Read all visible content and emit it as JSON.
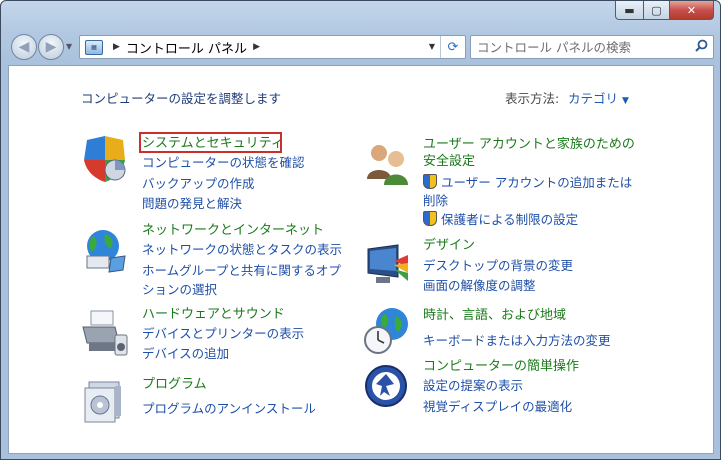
{
  "window": {
    "caption_buttons": {
      "minimize": "▬",
      "maximize": "▢",
      "close": "✕"
    }
  },
  "nav": {
    "back": "◀",
    "forward": "▶",
    "address_text": "コントロール パネル",
    "address_sep1": "▶",
    "address_sep2": "▶",
    "dropdown": "▼",
    "refresh": "⟳",
    "search_placeholder": "コントロール パネルの検索"
  },
  "content": {
    "header": "コンピューターの設定を調整します",
    "view_label": "表示方法:",
    "view_value": "カテゴリ",
    "view_arrow": "▼"
  },
  "categories": [
    {
      "title": "システムとセキュリティ",
      "links": [
        "コンピューターの状態を確認",
        "バックアップの作成",
        "問題の発見と解決"
      ]
    },
    {
      "title": "ネットワークとインターネット",
      "links": [
        "ネットワークの状態とタスクの表示",
        "ホームグループと共有に関するオプションの選択"
      ]
    },
    {
      "title": "ハードウェアとサウンド",
      "links": [
        "デバイスとプリンターの表示",
        "デバイスの追加"
      ]
    },
    {
      "title": "プログラム",
      "links": [
        "プログラムのアンインストール"
      ]
    },
    {
      "title": "ユーザー アカウントと家族のための安全設定",
      "links": [
        "ユーザー アカウントの追加または削除",
        "保護者による制限の設定"
      ]
    },
    {
      "title": "デザイン",
      "links": [
        "デスクトップの背景の変更",
        "画面の解像度の調整"
      ]
    },
    {
      "title": "時計、言語、および地域",
      "links": [
        "キーボードまたは入力方法の変更"
      ]
    },
    {
      "title": "コンピューターの簡単操作",
      "links": [
        "設定の提案の表示",
        "視覚ディスプレイの最適化"
      ]
    }
  ],
  "colors": {
    "title_green": "#1a7a1a",
    "link_blue": "#1e4fa8",
    "highlight_red": "#c9302c"
  }
}
